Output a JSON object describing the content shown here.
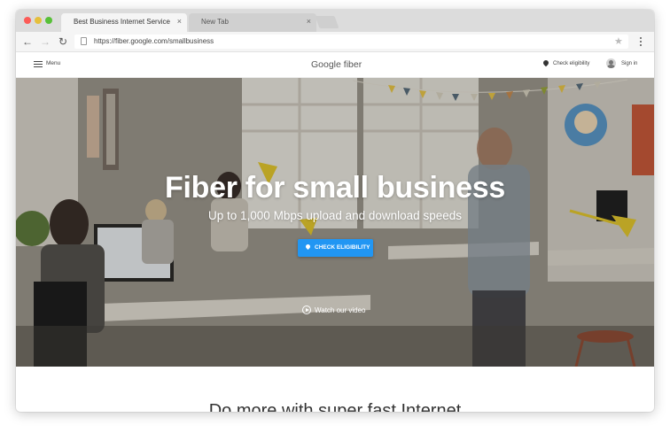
{
  "browser": {
    "tabs": [
      {
        "title": "Best Business Internet Service",
        "close": "×",
        "active": true
      },
      {
        "title": "New Tab",
        "close": "×",
        "active": false
      }
    ],
    "url": "https://fiber.google.com/smallbusiness",
    "back": "←",
    "forward": "→",
    "reload": "↻",
    "star": "★"
  },
  "header": {
    "menu_label": "Menu",
    "brand": "Google fiber",
    "check_eligibility": "Check eligibility",
    "sign_in": "Sign in"
  },
  "hero": {
    "title": "Fiber for small business",
    "subtitle": "Up to 1,000 Mbps upload and download speeds",
    "cta_label": "CHECK ELIGIBILITY",
    "video_label": "Watch our video"
  },
  "section": {
    "title": "Do more with super fast Internet"
  },
  "colors": {
    "accent": "#2196f3",
    "bunting": [
      "#e8c547",
      "#5a6e7d",
      "#d8d2c0",
      "#9aa63c",
      "#c98b4f"
    ]
  }
}
